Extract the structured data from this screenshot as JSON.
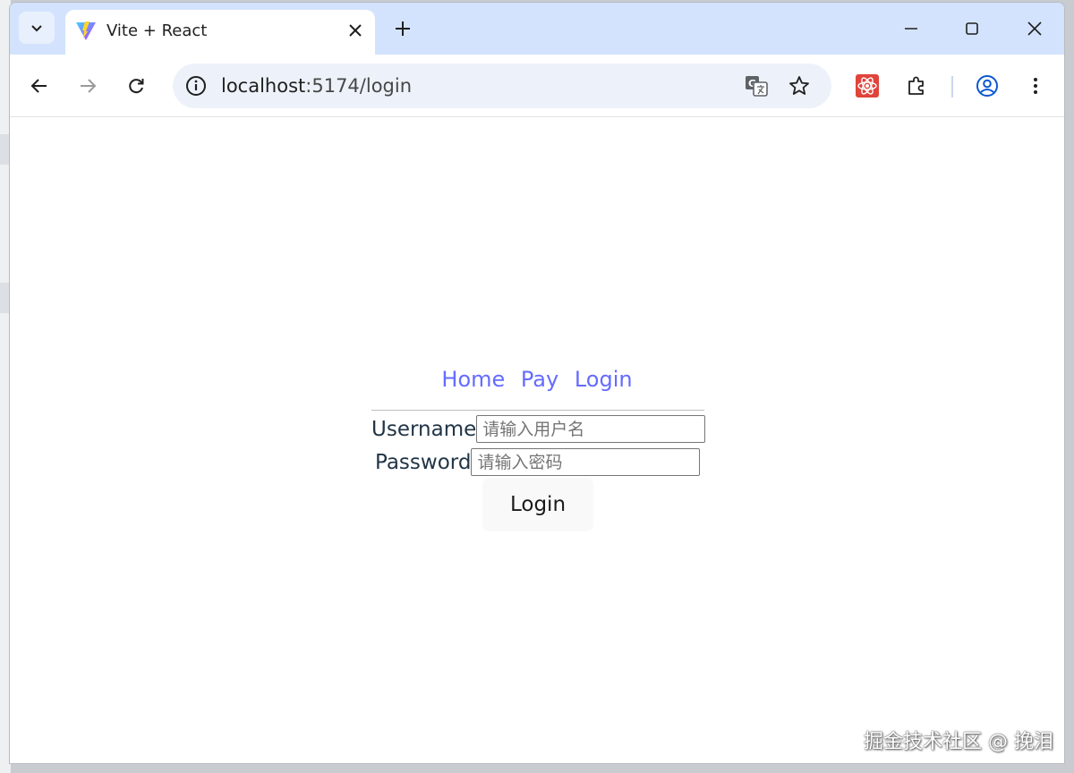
{
  "browser": {
    "tab": {
      "title": "Vite + React",
      "favicon": "vite-logo-icon"
    },
    "url_host": "localhost",
    "url_path": ":5174/login",
    "accent": "#d3e3fd"
  },
  "page": {
    "nav": [
      {
        "label": "Home"
      },
      {
        "label": "Pay"
      },
      {
        "label": "Login"
      }
    ],
    "link_color": "#646cff",
    "form": {
      "username_label": "Username",
      "username_placeholder": "请输入用户名",
      "password_label": "Password",
      "password_placeholder": "请输入密码",
      "submit_label": "Login"
    }
  },
  "watermark": "掘金技术社区 @ 挽泪"
}
